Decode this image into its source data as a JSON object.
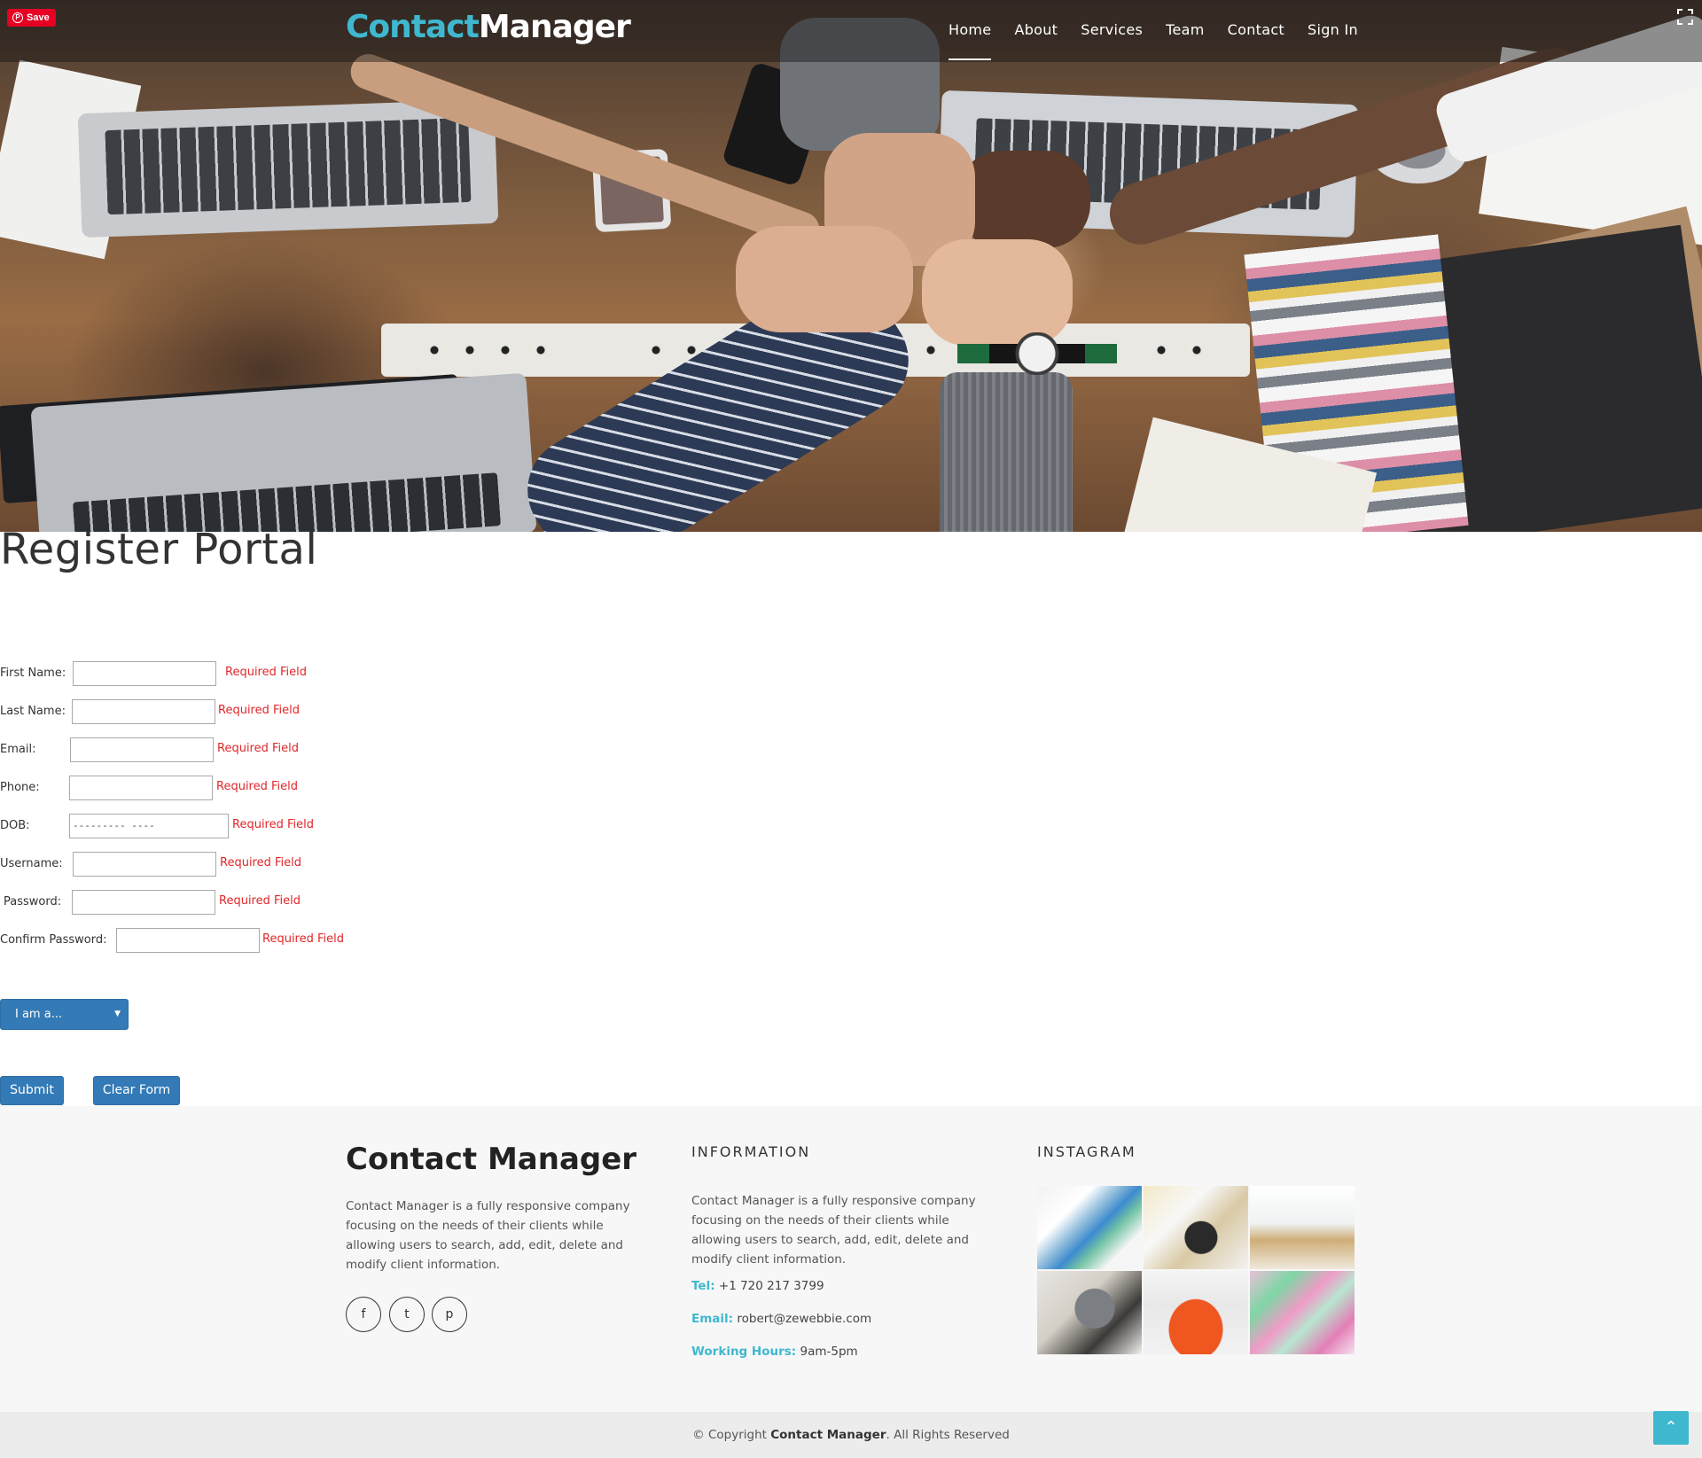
{
  "pinterest": {
    "save_label": "Save",
    "icon": "pinterest-icon"
  },
  "nav": {
    "logo_part1": "Contact",
    "logo_part2": "Manager",
    "items": [
      "Home",
      "About",
      "Services",
      "Team",
      "Contact",
      "Sign In"
    ],
    "active": "Home"
  },
  "page": {
    "title": "Register Portal"
  },
  "form": {
    "required_text": "Required Field",
    "fields": [
      {
        "label": "First Name:",
        "value": ""
      },
      {
        "label": "Last Name:",
        "value": ""
      },
      {
        "label": "Email:",
        "value": ""
      },
      {
        "label": "Phone:",
        "value": ""
      },
      {
        "label": "DOB:",
        "value": "---------  ----"
      },
      {
        "label": "Username:",
        "value": ""
      },
      {
        "label": "Password:",
        "value": ""
      },
      {
        "label": "Confirm Password:",
        "value": ""
      }
    ],
    "select_label": "I am a...",
    "submit_label": "Submit",
    "clear_label": "Clear Form"
  },
  "footer": {
    "brand": "Contact Manager",
    "about_text": "Contact Manager is a fully responsive company focusing on the needs of their clients while allowing users to search, add, edit, delete and modify client information.",
    "social_icons": [
      "facebook-icon",
      "twitter-icon",
      "pinterest-icon"
    ],
    "info_heading": "INFORMATION",
    "info_text": "Contact Manager is a fully responsive company focusing on the needs of their clients while allowing users to search, add, edit, delete and modify client information.",
    "tel_label": "Tel:",
    "tel_value": "+1 720 217 3799",
    "email_label": "Email:",
    "email_value": "robert@zewebbie.com",
    "hours_label": "Working Hours:",
    "hours_value": "9am-5pm",
    "instagram_heading": "INSTAGRAM",
    "copyright_prefix": "© Copyright",
    "copyright_brand": "Contact Manager",
    "copyright_suffix": ". All Rights Reserved"
  },
  "colors": {
    "accent": "#3fb8cf",
    "button": "#337ab7",
    "required": "#e0262a",
    "pinterest": "#e60023"
  }
}
